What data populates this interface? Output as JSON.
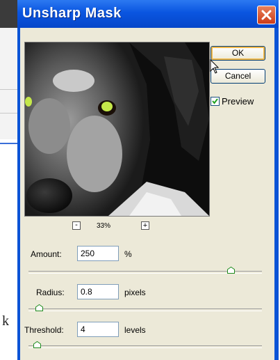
{
  "window": {
    "title": "Unsharp Mask"
  },
  "preview": {
    "zoom_level": "33%",
    "zoom_out_symbol": "-",
    "zoom_in_symbol": "+"
  },
  "buttons": {
    "ok": "OK",
    "cancel": "Cancel"
  },
  "preview_toggle": {
    "label": "Preview",
    "checked": true
  },
  "params": {
    "amount": {
      "label": "Amount:",
      "value": "250",
      "unit": "%",
      "slider_fraction": 0.88
    },
    "radius": {
      "label": "Radius:",
      "value": "0.8",
      "unit": "pixels",
      "slider_fraction": 0.03
    },
    "threshold": {
      "label": "Threshold:",
      "value": "4",
      "unit": "levels",
      "slider_fraction": 0.02
    }
  },
  "background_app": {
    "partial_letter": "k"
  },
  "colors": {
    "title_bar": "#0a55e0",
    "close_button": "#cd3b17",
    "dialog_face": "#ece9d8",
    "ok_focus": "#f1b849"
  }
}
